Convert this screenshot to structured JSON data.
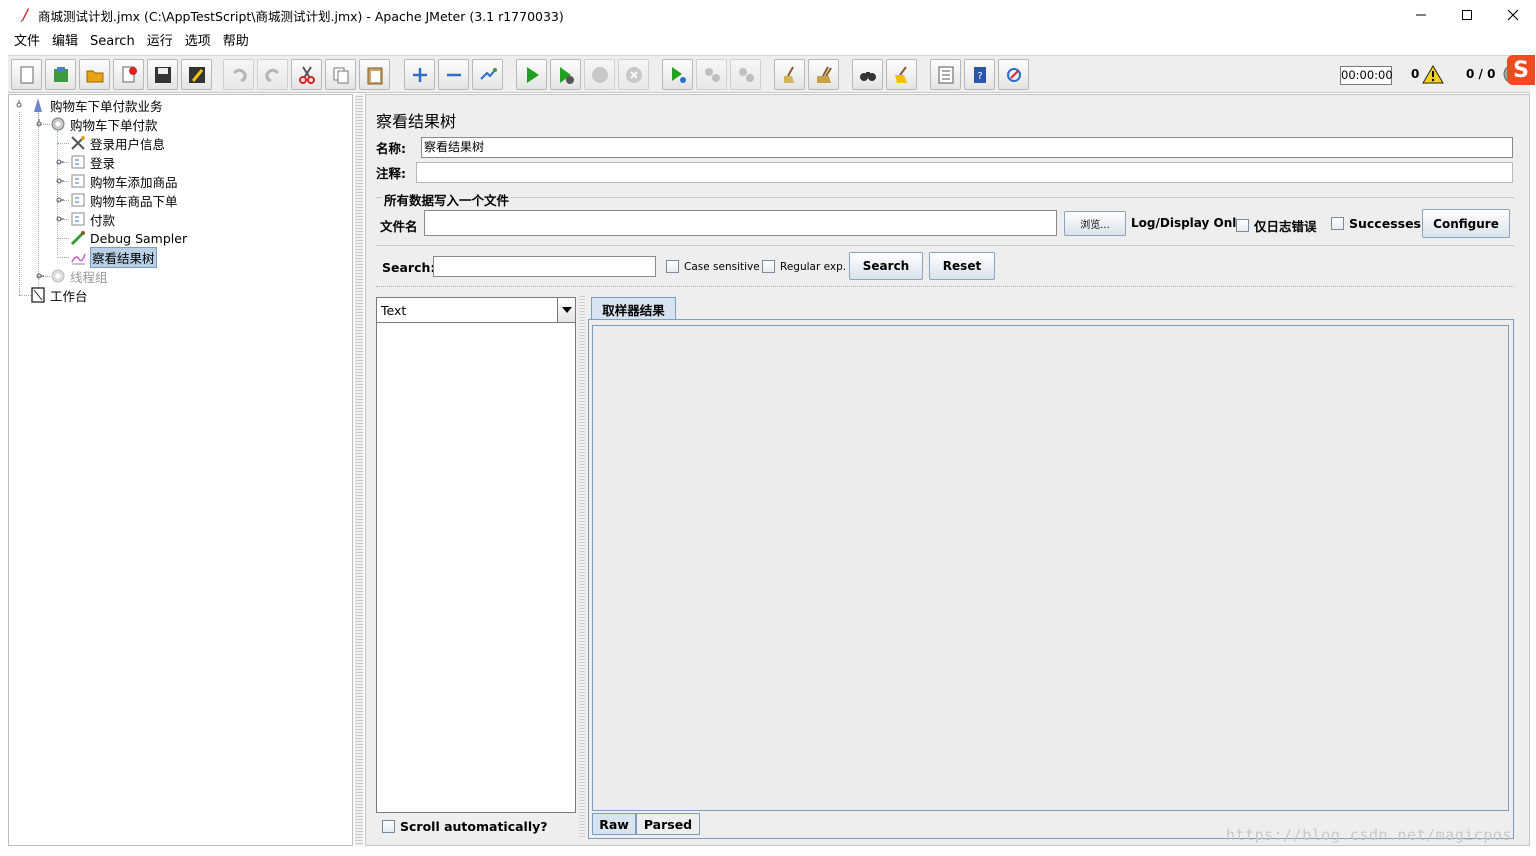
{
  "window": {
    "title": "商城测试计划.jmx (C:\\AppTestScript\\商城测试计划.jmx) - Apache JMeter (3.1 r1770033)"
  },
  "menu": [
    "文件",
    "编辑",
    "Search",
    "运行",
    "选项",
    "帮助"
  ],
  "status": {
    "timer": "00:00:00",
    "warnings": "0",
    "threads": "0 / 0"
  },
  "tree": {
    "nodes": [
      {
        "label": "购物车下单付款业务",
        "icon": "test-plan-icon"
      },
      {
        "label": "购物车下单付款",
        "icon": "thread-group-icon"
      },
      {
        "label": "登录用户信息",
        "icon": "config-tools-icon"
      },
      {
        "label": "登录",
        "icon": "sampler-icon"
      },
      {
        "label": "购物车添加商品",
        "icon": "sampler-icon"
      },
      {
        "label": "购物车商品下单",
        "icon": "sampler-icon"
      },
      {
        "label": "付款",
        "icon": "sampler-icon"
      },
      {
        "label": "Debug Sampler",
        "icon": "debug-sampler-icon"
      },
      {
        "label": "察看结果树",
        "icon": "view-results-tree-icon"
      },
      {
        "label": "线程组",
        "icon": "thread-group-disabled-icon"
      },
      {
        "label": "工作台",
        "icon": "workbench-icon"
      }
    ]
  },
  "panel": {
    "title": "察看结果树",
    "name_label": "名称:",
    "name_value": "察看结果树",
    "comment_label": "注释:",
    "comment_value": "",
    "file_group_title": "所有数据写入一个文件",
    "filename_label": "文件名",
    "filename_value": "",
    "browse_label": "浏览...",
    "log_display_label": "Log/Display Only:",
    "errors_only_label": "仅日志错误",
    "successes_label": "Successes",
    "configure_label": "Configure"
  },
  "search": {
    "label": "Search:",
    "value": "",
    "case_sensitive_label": "Case sensitive",
    "regex_label": "Regular exp.",
    "search_button": "Search",
    "reset_button": "Reset"
  },
  "results": {
    "renderer_selected": "Text",
    "scroll_auto_label": "Scroll automatically?",
    "tab_sampler_result": "取样器结果",
    "tab_raw": "Raw",
    "tab_parsed": "Parsed"
  },
  "watermark": "https://blog.csdn.net/magicpos",
  "colors": {
    "selection": "#b8cfe5",
    "tab_border": "#7b9dc2",
    "brand": "#f04a23"
  }
}
